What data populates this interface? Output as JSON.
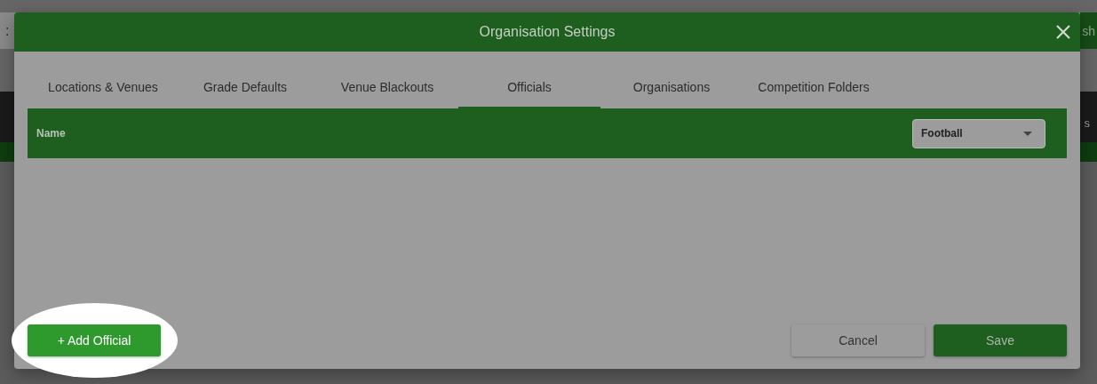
{
  "background": {
    "clock_text": ":",
    "top_button": "sh",
    "band_text": "s"
  },
  "dialog": {
    "title": "Organisation Settings",
    "tabs": [
      {
        "label": "Locations & Venues",
        "selected": false
      },
      {
        "label": "Grade Defaults",
        "selected": false
      },
      {
        "label": "Venue Blackouts",
        "selected": false
      },
      {
        "label": "Officials",
        "selected": true
      },
      {
        "label": "Organisations",
        "selected": false
      },
      {
        "label": "Competition Folders",
        "selected": false
      }
    ],
    "table": {
      "columns": [
        "Name"
      ]
    },
    "sport_select": {
      "value": "Football"
    },
    "add_button": {
      "label": "+ Add Official",
      "highlighted": true
    },
    "buttons": [
      {
        "label": "Cancel",
        "kind": "secondary"
      },
      {
        "label": "Save",
        "kind": "primary"
      }
    ]
  }
}
